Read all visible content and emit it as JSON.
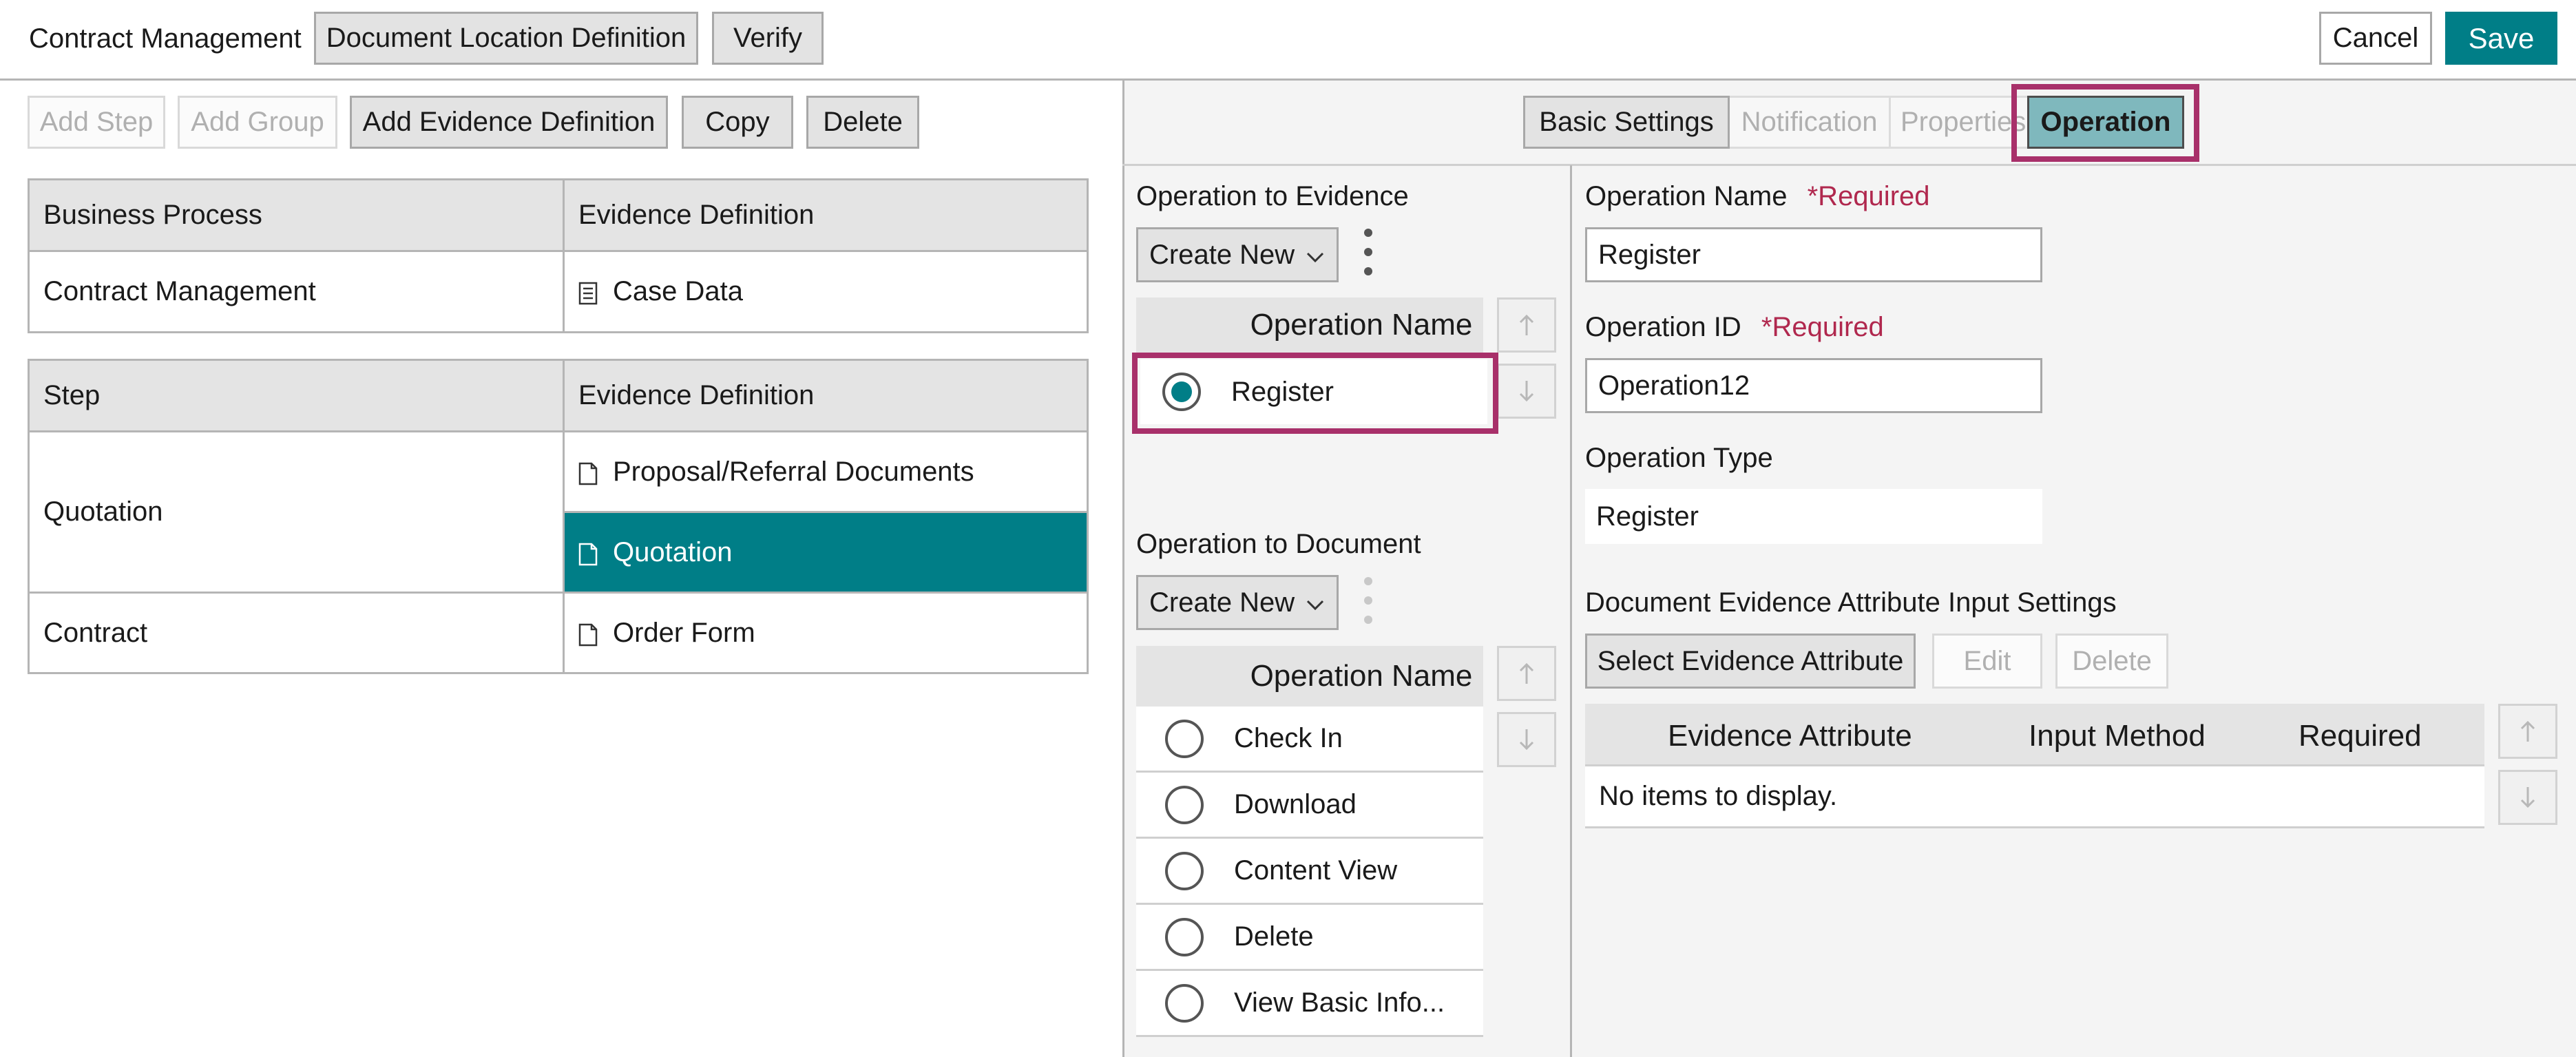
{
  "topbar": {
    "title": "Contract Management",
    "doc_location_button": "Document Location Definition",
    "verify_button": "Verify",
    "cancel_button": "Cancel",
    "save_button": "Save"
  },
  "left_toolbar": {
    "add_step": "Add Step",
    "add_group": "Add Group",
    "add_evidence_definition": "Add Evidence Definition",
    "copy": "Copy",
    "delete": "Delete"
  },
  "business_table": {
    "headers": [
      "Business Process",
      "Evidence Definition"
    ],
    "row": {
      "process": "Contract Management",
      "evidence": "Case Data"
    }
  },
  "step_table": {
    "headers": [
      "Step",
      "Evidence Definition"
    ],
    "rows": [
      {
        "step": "Quotation",
        "evidence": [
          "Proposal/Referral Documents",
          "Quotation"
        ]
      },
      {
        "step": "Contract",
        "evidence": [
          "Order Form"
        ]
      }
    ],
    "selected": "Quotation"
  },
  "tabs": {
    "basic_settings": "Basic Settings",
    "notification": "Notification",
    "properties": "Properties",
    "operation": "Operation",
    "active": "Operation"
  },
  "op_evidence": {
    "label": "Operation to Evidence",
    "create_new": "Create New",
    "column": "Operation Name",
    "items": [
      "Register"
    ],
    "selected": "Register"
  },
  "op_document": {
    "label": "Operation to Document",
    "create_new": "Create New",
    "column": "Operation Name",
    "items": [
      "Check In",
      "Download",
      "Content View",
      "Delete",
      "View Basic Info..."
    ]
  },
  "details": {
    "operation_name_label": "Operation Name",
    "operation_name_required": "*Required",
    "operation_name_value": "Register",
    "operation_id_label": "Operation ID",
    "operation_id_required": "*Required",
    "operation_id_value": "Operation12",
    "operation_type_label": "Operation Type",
    "operation_type_value": "Register",
    "doc_attr_settings_label": "Document Evidence Attribute Input Settings",
    "select_attr_button": "Select Evidence Attribute",
    "edit_button": "Edit",
    "delete_button": "Delete",
    "attr_table_headers": [
      "Evidence Attribute",
      "Input Method",
      "Required"
    ],
    "attr_table_empty": "No items to display."
  },
  "colors": {
    "accent": "#007e87",
    "highlight": "#a8306a",
    "required": "#b0284e"
  },
  "icons": [
    "document-icon",
    "list-icon",
    "arrow-up-icon",
    "arrow-down-icon",
    "chevron-down-icon",
    "kebab-menu-icon"
  ]
}
